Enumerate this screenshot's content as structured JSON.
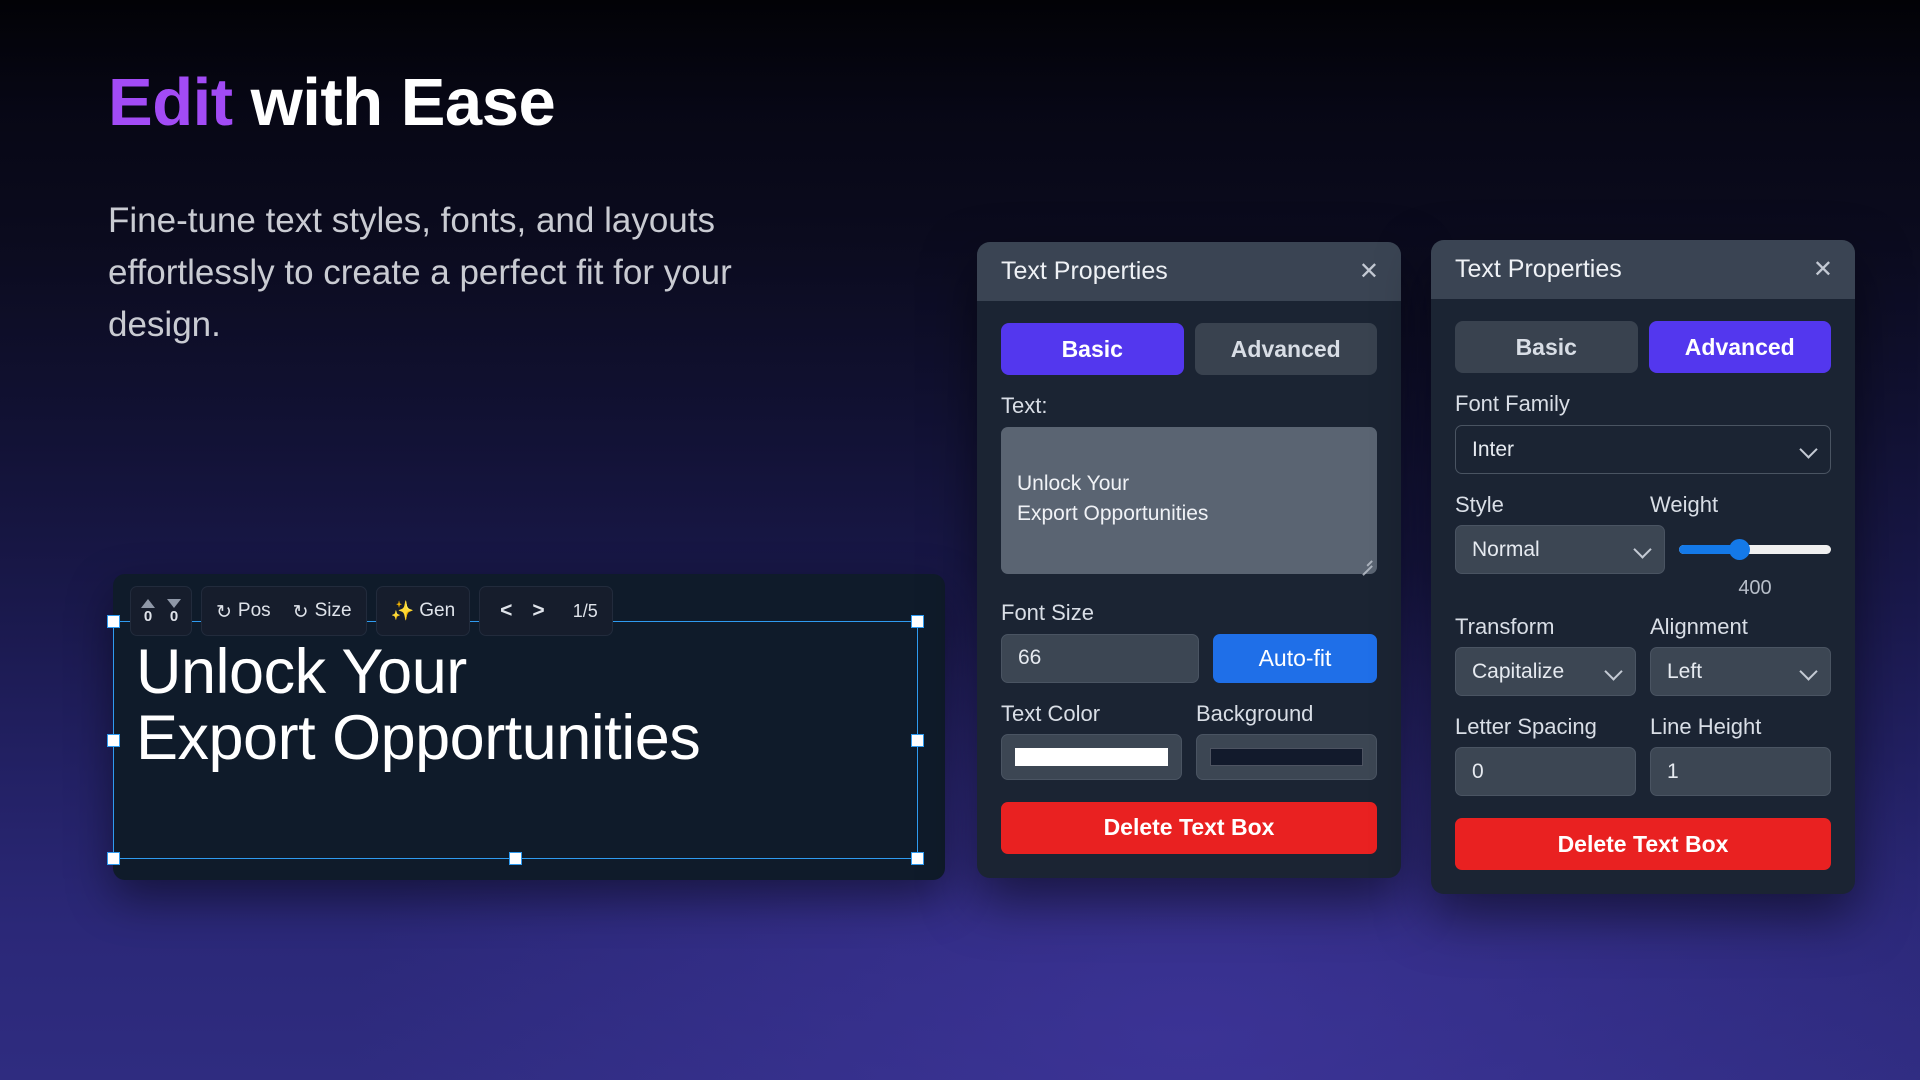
{
  "hero": {
    "title_accent": "Edit",
    "title_rest": " with Ease",
    "subtitle": "Fine-tune text styles, fonts, and layouts effortlessly to create a perfect fit for your design."
  },
  "canvas": {
    "text": "Unlock Your\nExport Opportunities",
    "toolbar": {
      "nudge_up_icon": "triangle-up-icon",
      "nudge_down_icon": "triangle-down-icon",
      "nudge_up_value": "0",
      "nudge_down_value": "0",
      "reset_pos_icon": "undo-icon",
      "reset_pos_label": "Pos",
      "reset_size_icon": "undo-icon",
      "reset_size_label": "Size",
      "gen_icon": "sparkles-icon",
      "gen_label": "Gen",
      "prev_label": "<",
      "next_label": ">",
      "page_indicator": "1/5"
    }
  },
  "panel_basic": {
    "title": "Text Properties",
    "close_icon": "close-icon",
    "tabs": [
      {
        "label": "Basic",
        "active": true
      },
      {
        "label": "Advanced",
        "active": false
      }
    ],
    "text_label": "Text:",
    "text_value": "Unlock Your\nExport Opportunities",
    "font_size_label": "Font Size",
    "font_size_value": "66",
    "autofit_label": "Auto-fit",
    "text_color_label": "Text Color",
    "text_color_value": "#ffffff",
    "background_label": "Background",
    "background_value": "#121a2c",
    "delete_label": "Delete Text Box"
  },
  "panel_advanced": {
    "title": "Text Properties",
    "close_icon": "close-icon",
    "tabs": [
      {
        "label": "Basic",
        "active": false
      },
      {
        "label": "Advanced",
        "active": true
      }
    ],
    "font_family_label": "Font Family",
    "font_family_value": "Inter",
    "style_label": "Style",
    "style_value": "Normal",
    "weight_label": "Weight",
    "weight_value": "400",
    "weight_percent": 40,
    "transform_label": "Transform",
    "transform_value": "Capitalize",
    "alignment_label": "Alignment",
    "alignment_value": "Left",
    "letter_spacing_label": "Letter Spacing",
    "letter_spacing_value": "0",
    "line_height_label": "Line Height",
    "line_height_value": "1",
    "delete_label": "Delete Text Box"
  },
  "colors": {
    "accent_purple": "#a24bf5",
    "tab_active": "#5337ee",
    "autofit_blue": "#1f6fe8",
    "delete_red": "#e92121",
    "selection_blue": "#2f9bf0",
    "slider_blue": "#1479e8",
    "sparkle_gold": "#f5b83d"
  }
}
